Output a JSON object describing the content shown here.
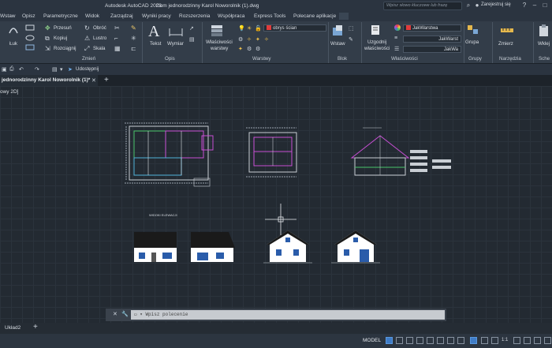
{
  "titlebar": {
    "app": "Autodesk AutoCAD 2023",
    "file": "Dom jednorodzinny Karol Noworolnik (1).dwg",
    "search_placeholder": "Wpisz słowo kluczowe lub frazę",
    "user": "Zarejestruj się"
  },
  "menu": [
    "Wstaw",
    "Opisz",
    "Parametryczne",
    "Widok",
    "Zarządzaj",
    "Wyniki pracy",
    "Rozszerzenia",
    "Współpraca",
    "Express Tools",
    "Polecane aplikacje"
  ],
  "ribbon": {
    "modify": {
      "items": [
        "Przesuń",
        "Obróć",
        "Kopiuj",
        "Lustro",
        "Rozciągnij",
        "Skala"
      ],
      "arc": "Łuk",
      "title": "Zmień"
    },
    "annotation": {
      "text": "Tekst",
      "dimension": "Wymiar",
      "title": "Opis"
    },
    "layers": {
      "props": [
        "Właściwości",
        "warstwy"
      ],
      "current_layer": "obrys ścian",
      "title": "Warstwy"
    },
    "block": {
      "insert": "Wstaw",
      "title": "Blok"
    },
    "properties": {
      "match": [
        "Uzgodnij",
        "właściwości"
      ],
      "color": "JakWarstwa",
      "linetype": "JakWarst",
      "lineweight": "JakWa",
      "title": "Właściwości"
    },
    "groups": {
      "group": "Grupa",
      "title": "Grupy"
    },
    "utilities": {
      "measure": "Zmierz",
      "title": "Narzędzia"
    },
    "clipboard": {
      "paste": "Wklej",
      "title": "Sche"
    }
  },
  "qa": {
    "share": "Udostępnij"
  },
  "tabs": {
    "active": "jednorodzinny Karol Noworolnik (1)*"
  },
  "view": {
    "label": "owy 2D]"
  },
  "drawing": {
    "elevations_label": "WIDOKI ELEWACJI"
  },
  "cmd": {
    "placeholder": "Wpisz polecenie"
  },
  "layout_tabs": {
    "layout": "Układ2"
  },
  "status": {
    "model": "MODEL",
    "scale": "1:1"
  },
  "colors": {
    "accent": "#3f7cc7",
    "roof": "#1a1a1a",
    "wall": "#ffffff",
    "window": "#2a5caa"
  }
}
